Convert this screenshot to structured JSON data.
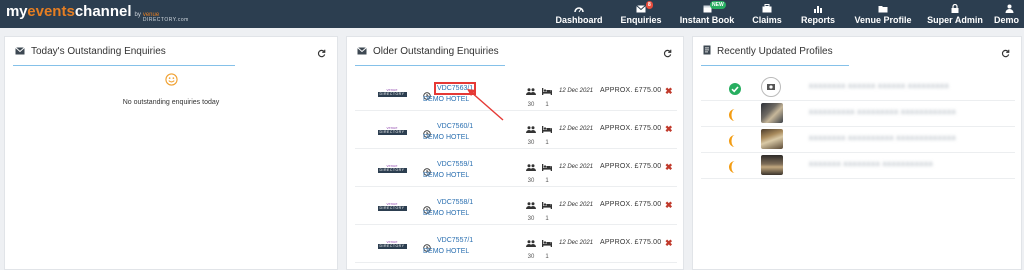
{
  "brand": {
    "my": "my",
    "events": "events",
    "channel": "channel",
    "by": "by",
    "vd_top": "venue",
    "vd_bottom": "DIRECTORY.com"
  },
  "nav": [
    {
      "label": "Dashboard",
      "icon": "dashboard-icon"
    },
    {
      "label": "Enquiries",
      "icon": "envelope-icon",
      "badge": "8"
    },
    {
      "label": "Instant Book",
      "icon": "instant-book-icon",
      "badge": "NEW"
    },
    {
      "label": "Claims",
      "icon": "claims-icon"
    },
    {
      "label": "Reports",
      "icon": "chart-icon"
    },
    {
      "label": "Venue Profile",
      "icon": "folder-icon"
    },
    {
      "label": "Super Admin",
      "icon": "lock-icon"
    },
    {
      "label": "Demo",
      "icon": "user-icon"
    }
  ],
  "panels": {
    "today": {
      "title": "Today's Outstanding Enquiries",
      "empty": "No outstanding enquiries today"
    },
    "older": {
      "title": "Older Outstanding Enquiries"
    },
    "profiles": {
      "title": "Recently Updated Profiles"
    }
  },
  "enquiries": [
    {
      "ref": "VDC7563/1",
      "hotel": "DEMO HOTEL",
      "people": "30",
      "rooms": "1",
      "date": "12 Dec 2021",
      "price": "APPROX. £775.00",
      "logo_top": "venue",
      "logo_bottom": "DIRECTORY"
    },
    {
      "ref": "VDC7560/1",
      "hotel": "DEMO HOTEL",
      "people": "30",
      "rooms": "1",
      "date": "12 Dec 2021",
      "price": "APPROX. £775.00",
      "logo_top": "venue",
      "logo_bottom": "DIRECTORY"
    },
    {
      "ref": "VDC7559/1",
      "hotel": "DEMO HOTEL",
      "people": "30",
      "rooms": "1",
      "date": "12 Dec 2021",
      "price": "APPROX. £775.00",
      "logo_top": "venue",
      "logo_bottom": "DIRECTORY"
    },
    {
      "ref": "VDC7558/1",
      "hotel": "DEMO HOTEL",
      "people": "30",
      "rooms": "1",
      "date": "12 Dec 2021",
      "price": "APPROX. £775.00",
      "logo_top": "venue",
      "logo_bottom": "DIRECTORY"
    },
    {
      "ref": "VDC7557/1",
      "hotel": "DEMO HOTEL",
      "people": "30",
      "rooms": "1",
      "date": "12 Dec 2021",
      "price": "APPROX. £775.00",
      "logo_top": "venue",
      "logo_bottom": "DIRECTORY"
    }
  ],
  "profiles": [
    {
      "status": "complete",
      "name": "XXXXXXXX XXXXXX XXXXXX XXXXXXXXX"
    },
    {
      "status": "partial",
      "name": "XXXXXXXXXX XXXXXXXXX XXXXXXXXXXXX"
    },
    {
      "status": "partial",
      "name": "XXXXXXXX XXXXXXXXXX XXXXXXXXXXXXX"
    },
    {
      "status": "partial",
      "name": "XXXXXXX XXXXXXXX XXXXXXXXXXX"
    }
  ],
  "colors": {
    "navbar": "#2c3e50",
    "accent": "#e67e22",
    "link": "#2a6fb0",
    "delete": "#c0392b",
    "success": "#27ae60",
    "partial": "#f39c12",
    "highlight": "#e53935"
  }
}
